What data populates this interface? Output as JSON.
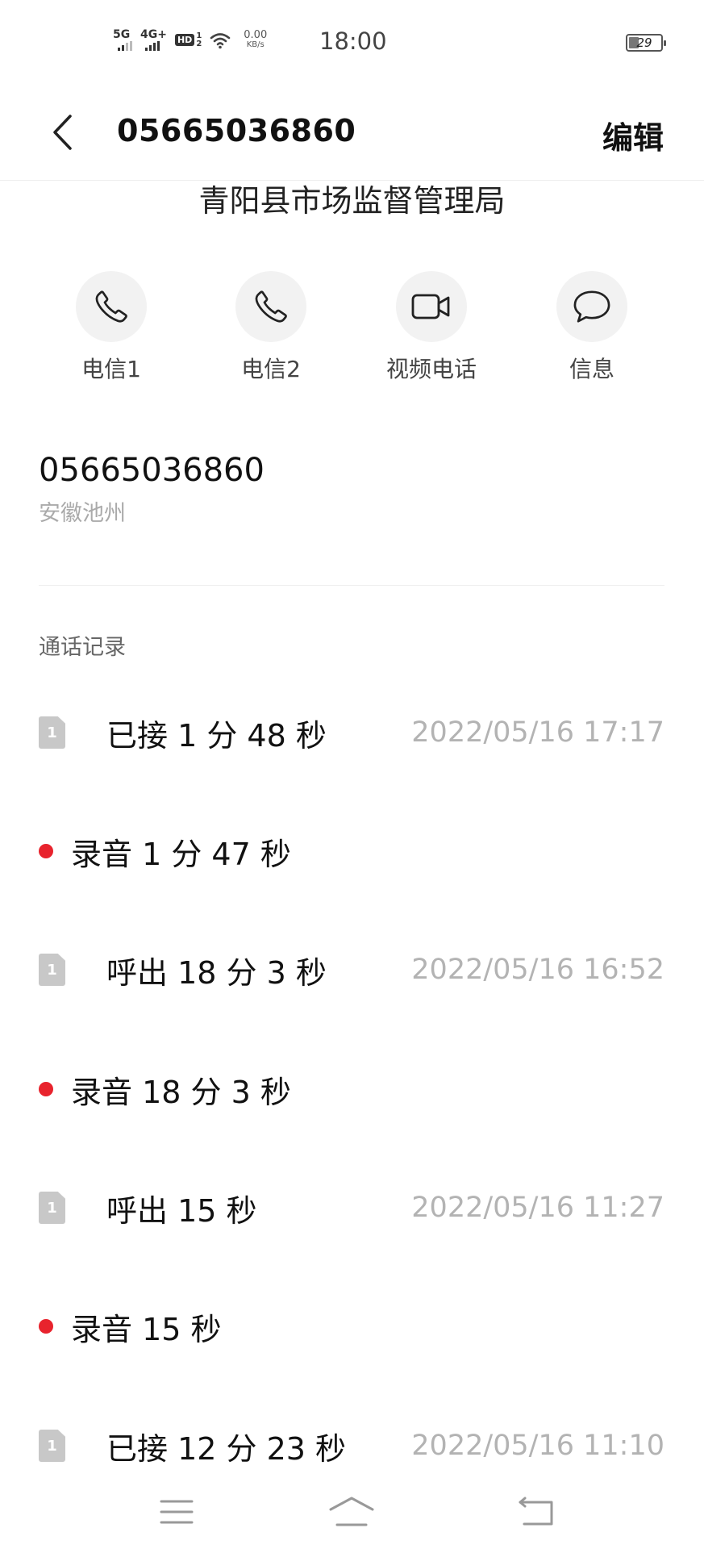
{
  "status_bar": {
    "signal1_label": "5G",
    "signal2_label": "4G+",
    "hd_label": "HD",
    "hd_sim1": "1",
    "hd_sim2": "2",
    "speed_value": "0.00",
    "speed_unit": "KB/s",
    "time": "18:00",
    "battery_level": "29",
    "battery_fraction": 0.29,
    "icons": [
      "signal-5g-icon",
      "signal-4g-icon",
      "hd-voice-icon",
      "wifi-icon",
      "battery-icon"
    ]
  },
  "header": {
    "title": "05665036860",
    "edit_label": "编辑",
    "back_icon": "chevron-left-icon"
  },
  "contact": {
    "name": "青阳县市场监督管理局",
    "number": "05665036860",
    "location": "安徽池州"
  },
  "actions": [
    {
      "label": "电信1",
      "icon": "phone-icon"
    },
    {
      "label": "电信2",
      "icon": "phone-icon"
    },
    {
      "label": "视频电话",
      "icon": "video-camera-icon"
    },
    {
      "label": "信息",
      "icon": "message-bubble-icon"
    }
  ],
  "call_log": {
    "title": "通话记录",
    "entries": [
      {
        "sim": "1",
        "type_duration": "已接 1 分 48 秒",
        "datetime": "2022/05/16 17:17",
        "recording": "录音 1 分 47 秒"
      },
      {
        "sim": "1",
        "type_duration": "呼出 18 分 3 秒",
        "datetime": "2022/05/16 16:52",
        "recording": "录音 18 分 3 秒"
      },
      {
        "sim": "1",
        "type_duration": "呼出 15 秒",
        "datetime": "2022/05/16 11:27",
        "recording": "录音 15 秒"
      },
      {
        "sim": "1",
        "type_duration": "已接 12 分 23 秒",
        "datetime": "2022/05/16 11:10"
      }
    ]
  },
  "nav_bar": {
    "icons": [
      "menu-icon",
      "home-icon",
      "back-icon"
    ]
  },
  "colors": {
    "recording_dot": "#e8232d",
    "timestamp": "#b3b3b3",
    "sim_badge": "#c8c8c8",
    "action_circle": "#f2f2f2"
  }
}
